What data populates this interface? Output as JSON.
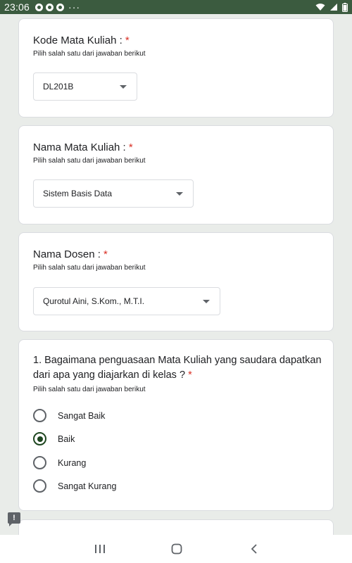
{
  "status_bar": {
    "time": "23:06",
    "icons": [
      "notification-icon",
      "notification-icon",
      "notification-icon",
      "more-notifications-icon",
      "wifi-icon",
      "signal-icon",
      "battery-icon"
    ],
    "more": "···"
  },
  "form": {
    "questions": [
      {
        "title": "Kode Mata Kuliah : ",
        "required_mark": "*",
        "help": "Pilih salah satu dari jawaban berikut",
        "selected": "DL201B"
      },
      {
        "title": "Nama Mata Kuliah : ",
        "required_mark": "*",
        "help": "Pilih salah satu dari jawaban berikut",
        "selected": "Sistem Basis Data"
      },
      {
        "title": "Nama Dosen : ",
        "required_mark": "*",
        "help": "Pilih salah satu dari jawaban berikut",
        "selected": "Qurotul Aini, S.Kom., M.T.I."
      },
      {
        "title": "1. Bagaimana penguasaan Mata Kuliah yang saudara dapatkan dari apa yang diajarkan di kelas ? ",
        "required_mark": "*",
        "help": "Pilih salah satu dari jawaban berikut",
        "options": [
          "Sangat Baik",
          "Baik",
          "Kurang",
          "Sangat Kurang"
        ],
        "selected_option": "Baik"
      }
    ]
  },
  "feedback": {
    "icon": "feedback-icon",
    "glyph": "!"
  },
  "nav_bar": {
    "buttons": [
      "recent-apps-icon",
      "home-icon",
      "back-icon"
    ]
  },
  "colors": {
    "status_bar": "#3b5b3f",
    "accent": "#1e4620",
    "required": "#d93025",
    "background": "#e9ece9"
  }
}
